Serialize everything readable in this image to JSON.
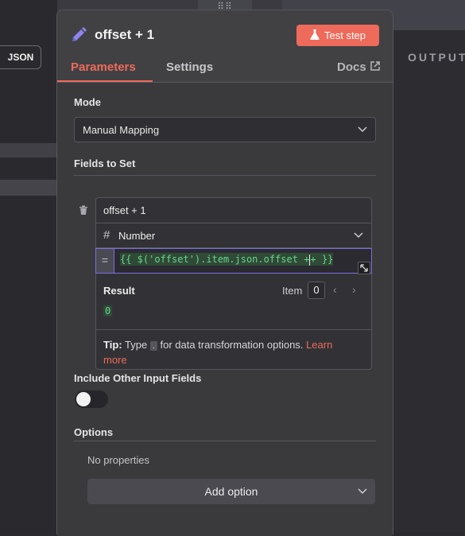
{
  "background": {
    "json_button_label": "JSON",
    "output_label": "OUTPUT",
    "drag_handle": "⠿⠿"
  },
  "node": {
    "title": "offset + 1",
    "test_step_label": "Test step"
  },
  "tabs": [
    {
      "label": "Parameters",
      "active": true
    },
    {
      "label": "Settings",
      "active": false
    }
  ],
  "docs_label": "Docs",
  "mode": {
    "label": "Mode",
    "value": "Manual Mapping"
  },
  "fields_to_set": {
    "label": "Fields to Set",
    "field": {
      "name": "offset + 1",
      "type": "Number",
      "expression_open": "{{ $('offset').item.json.offset +",
      "expression_after_cursor": "+ }}",
      "result_label": "Result",
      "item_label": "Item",
      "item_index": "0",
      "result_value": "0",
      "tip_label": "Tip:",
      "tip_text_1": "Type",
      "tip_key": ".",
      "tip_text_2": "for data transformation options.",
      "tip_link": "Learn more"
    }
  },
  "include_other": {
    "label": "Include Other Input Fields",
    "enabled": false
  },
  "options": {
    "label": "Options",
    "empty_text": "No properties",
    "add_option_label": "Add option"
  },
  "colors": {
    "accent": "#ee6a5a",
    "expression_border": "#7c6fe0",
    "expression_text": "#6ad48a"
  }
}
